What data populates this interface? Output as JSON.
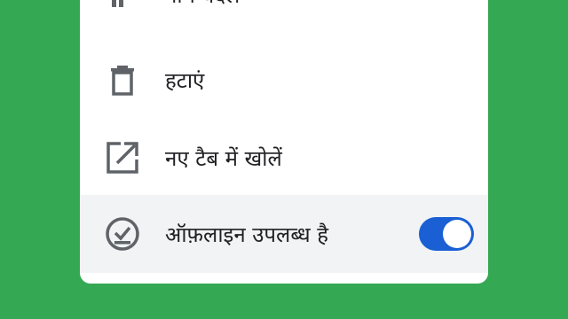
{
  "menu": {
    "items": [
      {
        "label": "नाम बदलें",
        "icon": "rename-icon"
      },
      {
        "label": "हटाएं",
        "icon": "trash-icon"
      },
      {
        "label": "नए टैब में खोलें",
        "icon": "open-in-new-tab-icon"
      },
      {
        "label": "ऑफ़लाइन उपलब्ध है",
        "icon": "offline-pin-icon",
        "toggle_on": true
      }
    ]
  },
  "colors": {
    "background": "#34a853",
    "sheet": "#ffffff",
    "selected_row": "#f1f3f4",
    "toggle_on": "#1a5fd4",
    "icon": "#5f6368"
  }
}
